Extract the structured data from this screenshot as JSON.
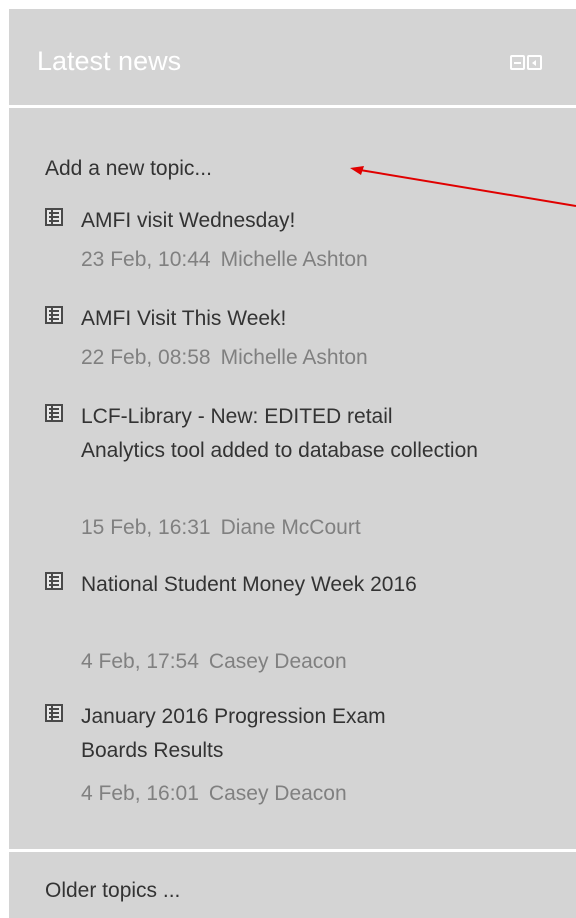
{
  "block": {
    "title": "Latest news",
    "add_topic": "Add a new topic...",
    "older_topics": "Older topics ...",
    "icons": [
      "dock-icon",
      "collapse-icon"
    ]
  },
  "posts": [
    {
      "subject": "AMFI visit Wednesday!",
      "date": "23 Feb, 10:44",
      "author": "Michelle Ashton"
    },
    {
      "subject": "AMFI Visit This Week!",
      "date": "22 Feb, 08:58",
      "author": "Michelle Ashton"
    },
    {
      "subject": "LCF-Library - New: EDITED retail Analytics tool added to database collection",
      "date": "15 Feb, 16:31",
      "author": "Diane McCourt"
    },
    {
      "subject": "National Student Money Week 2016",
      "date": "4 Feb, 17:54",
      "author": "Casey Deacon"
    },
    {
      "subject": "January 2016 Progression Exam Boards Results",
      "date": "4 Feb, 16:01",
      "author": "Casey Deacon"
    }
  ],
  "colors": {
    "annotation_arrow": "#e00000",
    "block_bg": "#d4d4d4"
  }
}
